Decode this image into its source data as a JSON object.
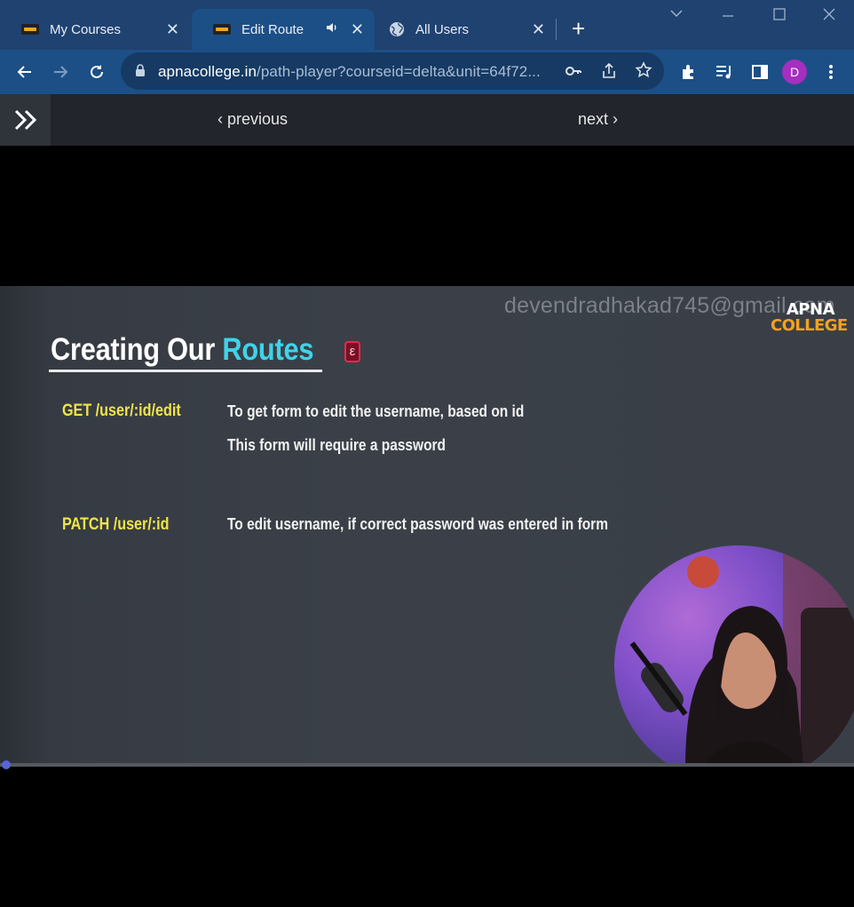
{
  "browser": {
    "tabs": [
      {
        "label": "My Courses",
        "icon": "apna-college-favicon",
        "active": false
      },
      {
        "label": "Edit Route",
        "icon": "apna-college-favicon",
        "active": true,
        "audio": true
      },
      {
        "label": "All Users",
        "icon": "globe-icon",
        "active": false
      }
    ],
    "url_domain": "apnacollege.in",
    "url_rest": "/path-player?courseid=delta&unit=64f72...",
    "profile_initial": "D",
    "colors": {
      "tabstrip": "#1f4271",
      "toolbar": "#1c4f86",
      "avatar": "#a52fbf"
    }
  },
  "page_nav": {
    "previous_label": "previous",
    "next_label": "next"
  },
  "slide": {
    "watermark": "devendradhakad745@gmail.com",
    "brand_top": "APNA",
    "brand_bottom": "COLLEGE",
    "title_prefix": "Creating Our ",
    "title_highlight": "Routes",
    "routes": [
      {
        "method": "GET /user/:id/edit",
        "descriptions": [
          "To get form to edit the username, based on id",
          "This form will require a password"
        ]
      },
      {
        "method": "PATCH /user/:id",
        "descriptions": [
          "To edit username, if correct password was entered in form"
        ]
      }
    ],
    "colors": {
      "method": "#efe44a",
      "highlight": "#3fd3e8",
      "brand_accent": "#f3a21d"
    }
  },
  "player": {
    "progress_fraction": 0.005
  }
}
